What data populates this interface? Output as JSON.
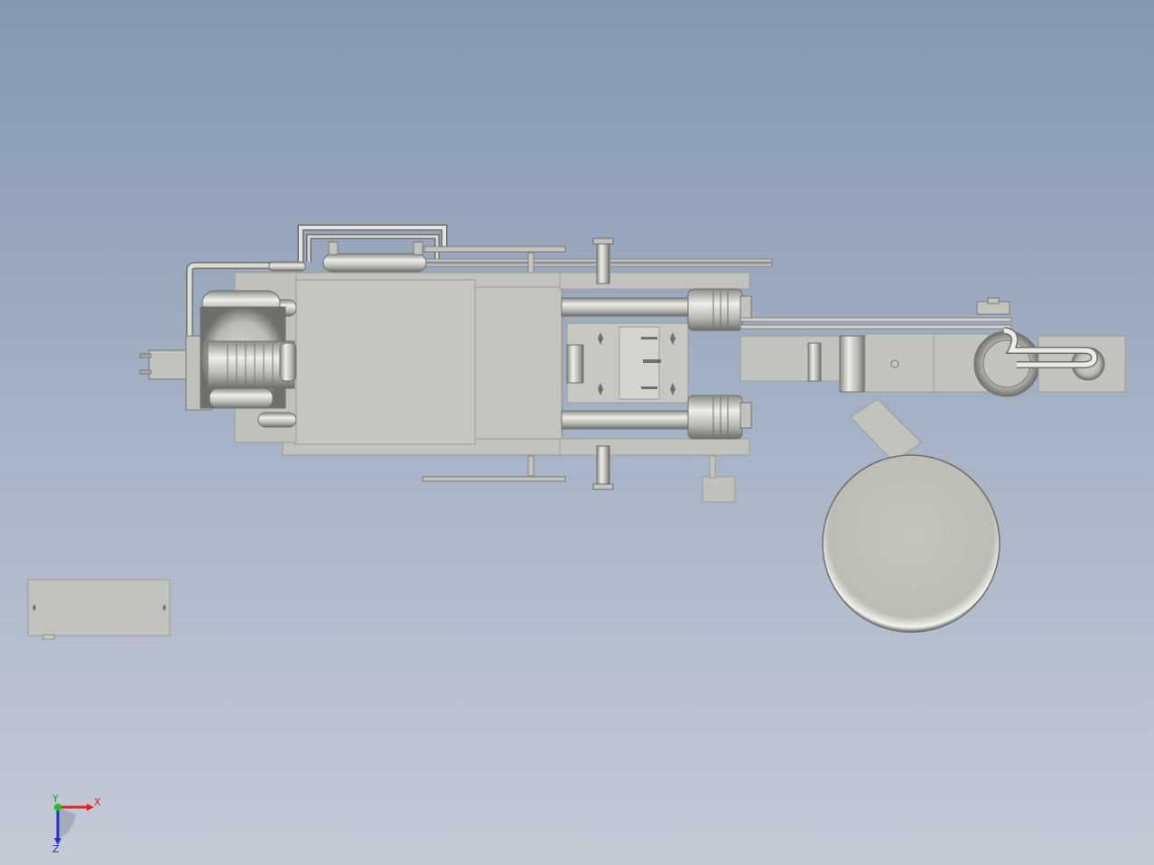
{
  "viewport": {
    "background_top": "#8597b0",
    "background_bottom": "#c5cad6",
    "part_color": "#c3c3bd",
    "edge_color": "#6f6f6b"
  },
  "triad": {
    "x_label": "X",
    "y_label": "Y",
    "z_label": "Z",
    "x_color": "#e02020",
    "y_color": "#20c020",
    "z_color": "#2030d0"
  }
}
